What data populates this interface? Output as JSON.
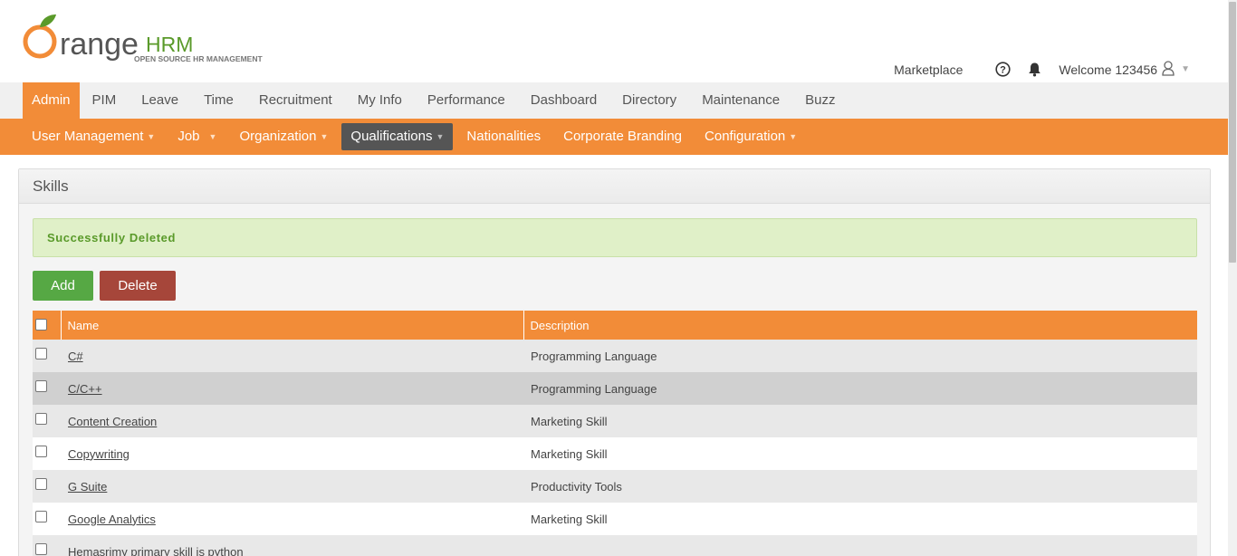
{
  "brand": {
    "logo_orange_o": "O",
    "logo_range": "range",
    "logo_hrm": "HRM",
    "logo_tagline": "OPEN SOURCE HR MANAGEMENT",
    "colors": {
      "orange": "#f28c38",
      "green": "#56a844",
      "red": "#a6463a",
      "dark": "#555555"
    }
  },
  "top_links": {
    "marketplace": "Marketplace",
    "help_icon": "help-circle-icon",
    "bell_icon": "bell-icon",
    "welcome": "Welcome 123456",
    "user_icon": "user-icon"
  },
  "main_nav": [
    {
      "label": "Admin",
      "active": true
    },
    {
      "label": "PIM"
    },
    {
      "label": "Leave"
    },
    {
      "label": "Time"
    },
    {
      "label": "Recruitment"
    },
    {
      "label": "My Info"
    },
    {
      "label": "Performance"
    },
    {
      "label": "Dashboard"
    },
    {
      "label": "Directory"
    },
    {
      "label": "Maintenance"
    },
    {
      "label": "Buzz"
    }
  ],
  "sub_nav": [
    {
      "label": "User Management",
      "dropdown": true
    },
    {
      "label": "Job",
      "dropdown": true
    },
    {
      "label": "Organization",
      "dropdown": true
    },
    {
      "label": "Qualifications",
      "dropdown": true,
      "active": true
    },
    {
      "label": "Nationalities"
    },
    {
      "label": "Corporate Branding"
    },
    {
      "label": "Configuration",
      "dropdown": true
    }
  ],
  "box": {
    "title": "Skills",
    "message": "Successfully Deleted",
    "add_label": "Add",
    "delete_label": "Delete"
  },
  "table": {
    "headers": {
      "name": "Name",
      "description": "Description"
    },
    "rows": [
      {
        "name": "C#",
        "description": "Programming Language"
      },
      {
        "name": "C/C++",
        "description": "Programming Language"
      },
      {
        "name": "Content Creation",
        "description": "Marketing Skill"
      },
      {
        "name": "Copywriting",
        "description": "Marketing Skill"
      },
      {
        "name": "G Suite",
        "description": "Productivity Tools"
      },
      {
        "name": "Google Analytics",
        "description": "Marketing Skill"
      },
      {
        "name": "Hemasrimy primary skill is python",
        "description": ""
      }
    ]
  }
}
